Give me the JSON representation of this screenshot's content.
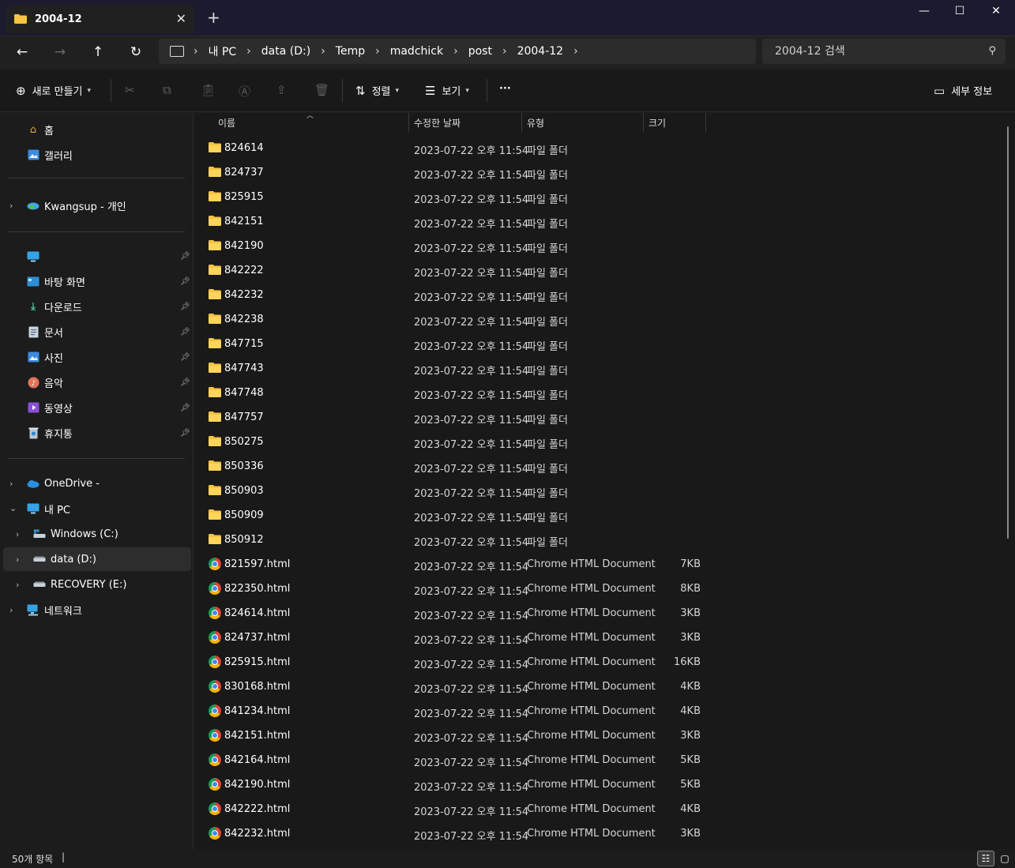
{
  "window": {
    "tab_title": "2004-12",
    "tab_close": "✕",
    "new_tab": "+",
    "minimize": "—",
    "maximize": "☐",
    "close": "✕"
  },
  "nav": {
    "breadcrumb": [
      "내 PC",
      "data (D:)",
      "Temp",
      "madchick",
      "post",
      "2004-12"
    ],
    "search_placeholder": "2004-12 검색"
  },
  "toolbar": {
    "new_label": "새로 만들기",
    "sort_label": "정렬",
    "view_label": "보기",
    "more_label": "···",
    "details_label": "세부 정보"
  },
  "sidebar": {
    "home": "홈",
    "gallery": "갤러리",
    "cloud": "Kwangsup - 개인",
    "quick": [
      {
        "label": "",
        "icon": "monitor-icon"
      },
      {
        "label": "바탕 화면",
        "icon": "desktop-icon"
      },
      {
        "label": "다운로드",
        "icon": "download-icon"
      },
      {
        "label": "문서",
        "icon": "document-icon"
      },
      {
        "label": "사진",
        "icon": "picture-icon"
      },
      {
        "label": "음악",
        "icon": "music-icon"
      },
      {
        "label": "동영상",
        "icon": "video-icon"
      },
      {
        "label": "휴지통",
        "icon": "recycle-bin-icon"
      }
    ],
    "onedrive": "OneDrive -",
    "this_pc": "내 PC",
    "drives": [
      "Windows (C:)",
      "data (D:)",
      "RECOVERY (E:)"
    ],
    "network": "네트워크"
  },
  "columns": {
    "name": "이름",
    "date": "수정한 날짜",
    "type": "유형",
    "size": "크기"
  },
  "files": [
    {
      "name": "824614",
      "date": "2023-07-22 오후 11:54",
      "type": "파일 폴더",
      "size": "",
      "kind": "folder"
    },
    {
      "name": "824737",
      "date": "2023-07-22 오후 11:54",
      "type": "파일 폴더",
      "size": "",
      "kind": "folder"
    },
    {
      "name": "825915",
      "date": "2023-07-22 오후 11:54",
      "type": "파일 폴더",
      "size": "",
      "kind": "folder"
    },
    {
      "name": "842151",
      "date": "2023-07-22 오후 11:54",
      "type": "파일 폴더",
      "size": "",
      "kind": "folder"
    },
    {
      "name": "842190",
      "date": "2023-07-22 오후 11:54",
      "type": "파일 폴더",
      "size": "",
      "kind": "folder"
    },
    {
      "name": "842222",
      "date": "2023-07-22 오후 11:54",
      "type": "파일 폴더",
      "size": "",
      "kind": "folder"
    },
    {
      "name": "842232",
      "date": "2023-07-22 오후 11:54",
      "type": "파일 폴더",
      "size": "",
      "kind": "folder"
    },
    {
      "name": "842238",
      "date": "2023-07-22 오후 11:54",
      "type": "파일 폴더",
      "size": "",
      "kind": "folder"
    },
    {
      "name": "847715",
      "date": "2023-07-22 오후 11:54",
      "type": "파일 폴더",
      "size": "",
      "kind": "folder"
    },
    {
      "name": "847743",
      "date": "2023-07-22 오후 11:54",
      "type": "파일 폴더",
      "size": "",
      "kind": "folder"
    },
    {
      "name": "847748",
      "date": "2023-07-22 오후 11:54",
      "type": "파일 폴더",
      "size": "",
      "kind": "folder"
    },
    {
      "name": "847757",
      "date": "2023-07-22 오후 11:54",
      "type": "파일 폴더",
      "size": "",
      "kind": "folder"
    },
    {
      "name": "850275",
      "date": "2023-07-22 오후 11:54",
      "type": "파일 폴더",
      "size": "",
      "kind": "folder"
    },
    {
      "name": "850336",
      "date": "2023-07-22 오후 11:54",
      "type": "파일 폴더",
      "size": "",
      "kind": "folder"
    },
    {
      "name": "850903",
      "date": "2023-07-22 오후 11:54",
      "type": "파일 폴더",
      "size": "",
      "kind": "folder"
    },
    {
      "name": "850909",
      "date": "2023-07-22 오후 11:54",
      "type": "파일 폴더",
      "size": "",
      "kind": "folder"
    },
    {
      "name": "850912",
      "date": "2023-07-22 오후 11:54",
      "type": "파일 폴더",
      "size": "",
      "kind": "folder"
    },
    {
      "name": "821597.html",
      "date": "2023-07-22 오후 11:54",
      "type": "Chrome HTML Document",
      "size": "7KB",
      "kind": "html"
    },
    {
      "name": "822350.html",
      "date": "2023-07-22 오후 11:54",
      "type": "Chrome HTML Document",
      "size": "8KB",
      "kind": "html"
    },
    {
      "name": "824614.html",
      "date": "2023-07-22 오후 11:54",
      "type": "Chrome HTML Document",
      "size": "3KB",
      "kind": "html"
    },
    {
      "name": "824737.html",
      "date": "2023-07-22 오후 11:54",
      "type": "Chrome HTML Document",
      "size": "3KB",
      "kind": "html"
    },
    {
      "name": "825915.html",
      "date": "2023-07-22 오후 11:54",
      "type": "Chrome HTML Document",
      "size": "16KB",
      "kind": "html"
    },
    {
      "name": "830168.html",
      "date": "2023-07-22 오후 11:54",
      "type": "Chrome HTML Document",
      "size": "4KB",
      "kind": "html"
    },
    {
      "name": "841234.html",
      "date": "2023-07-22 오후 11:54",
      "type": "Chrome HTML Document",
      "size": "4KB",
      "kind": "html"
    },
    {
      "name": "842151.html",
      "date": "2023-07-22 오후 11:54",
      "type": "Chrome HTML Document",
      "size": "3KB",
      "kind": "html"
    },
    {
      "name": "842164.html",
      "date": "2023-07-22 오후 11:54",
      "type": "Chrome HTML Document",
      "size": "5KB",
      "kind": "html"
    },
    {
      "name": "842190.html",
      "date": "2023-07-22 오후 11:54",
      "type": "Chrome HTML Document",
      "size": "5KB",
      "kind": "html"
    },
    {
      "name": "842222.html",
      "date": "2023-07-22 오후 11:54",
      "type": "Chrome HTML Document",
      "size": "4KB",
      "kind": "html"
    },
    {
      "name": "842232.html",
      "date": "2023-07-22 오후 11:54",
      "type": "Chrome HTML Document",
      "size": "3KB",
      "kind": "html"
    }
  ],
  "status": {
    "count": "50개 항목",
    "caret": "|"
  },
  "colors": {
    "folder": "#f6c343",
    "accent": "#4cc2ff"
  }
}
